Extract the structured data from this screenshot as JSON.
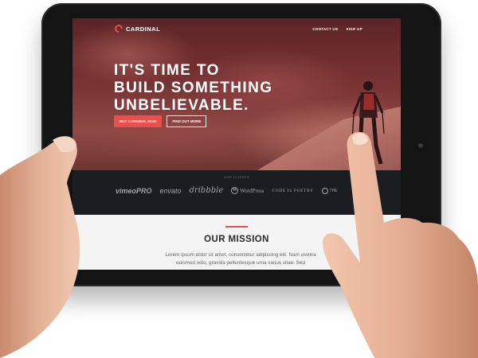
{
  "site": {
    "brand": "CARDINAL",
    "nav": [
      "CONTACT US",
      "SIGN UP"
    ],
    "hero": {
      "title_lines": [
        "IT'S TIME TO",
        "BUILD SOMETHING",
        "UNBELIEVABLE."
      ],
      "primary_cta": "BUY CARDINAL NOW",
      "secondary_cta": "FIND OUT MORE"
    },
    "clients": {
      "label": "OUR CLIENTS",
      "logos": [
        "vimeoPRO",
        "envato",
        "dribbble",
        "WordPress",
        "CODE IS POETRY",
        "THE"
      ]
    },
    "mission": {
      "title": "OUR MISSION",
      "text": "Lorem ipsum dolor sit amet, consectetur adipiscing elit. Nam viverra euismod odio, gravida pellentesque urna varius vitae. Sed"
    }
  },
  "icons": {
    "logo": "cardinal-logo-icon",
    "wordpress": "wordpress-logo-icon",
    "camera": "camera-icon"
  },
  "colors": {
    "accent": "#e9504b",
    "hero_tint": "#7a3434",
    "clients_band": "#1b1e21",
    "tablet_frame": "#141414"
  }
}
